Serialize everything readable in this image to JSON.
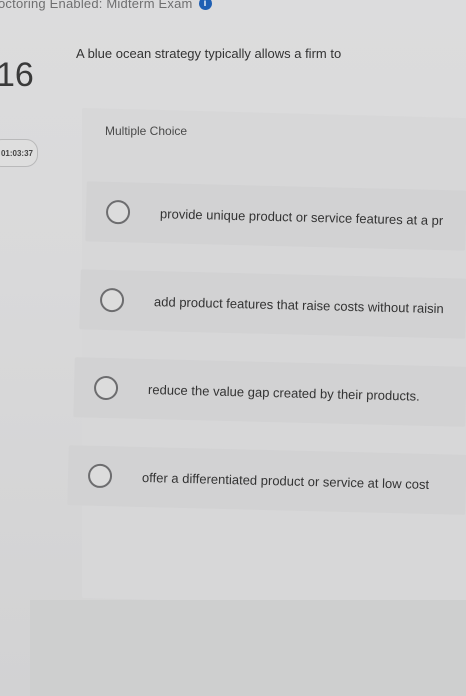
{
  "header": {
    "banner_text": "octoring Enabled: Midterm Exam",
    "info_icon_glyph": "i"
  },
  "question": {
    "number": "16",
    "timer": "01:03:37",
    "prompt": "A blue ocean strategy typically allows a firm to",
    "type_label": "Multiple Choice"
  },
  "choices": [
    {
      "text": "provide unique product or service features at a pr"
    },
    {
      "text": "add product features that raise costs without raisin"
    },
    {
      "text": "reduce the value gap created by their products."
    },
    {
      "text": "offer a differentiated product or service at low cost"
    }
  ],
  "colors": {
    "background": "#dadadb",
    "accent": "#1f5fb3"
  }
}
